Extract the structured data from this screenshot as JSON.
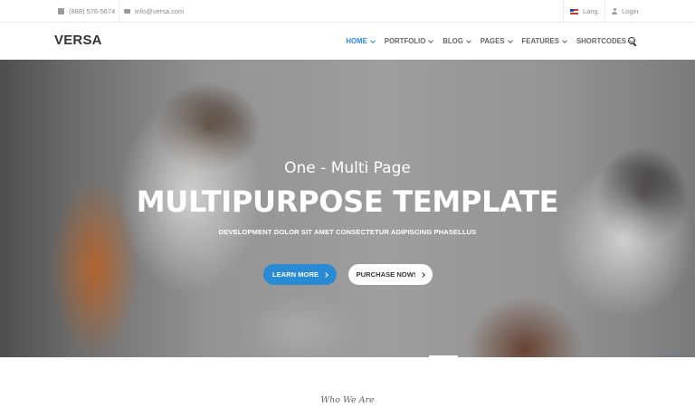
{
  "topbar": {
    "phone": "(888) 576-5674",
    "email": "info@versa.com",
    "language": "Lang.",
    "login": "Login"
  },
  "header": {
    "logo": "VERSA",
    "nav": [
      {
        "label": "HOME",
        "active": true
      },
      {
        "label": "PORTFOLIO",
        "active": false
      },
      {
        "label": "BLOG",
        "active": false
      },
      {
        "label": "PAGES",
        "active": false
      },
      {
        "label": "FEATURES",
        "active": false
      },
      {
        "label": "SHORTCODES",
        "active": false
      }
    ],
    "search_icon": "search-icon"
  },
  "hero": {
    "subtitle": "One - Multi Page",
    "title": "MULTIPURPOSE TEMPLATE",
    "description": "DEVELOPMENT DOLOR SIT AMET CONSECTETUR ADIPISCING PHASELLUS",
    "primary_button": "LEARN MORE",
    "secondary_button": "PURCHASE NOW!"
  },
  "section": {
    "title": "Who We Are"
  },
  "colors": {
    "accent": "#2a8ad3",
    "text": "#666666"
  }
}
